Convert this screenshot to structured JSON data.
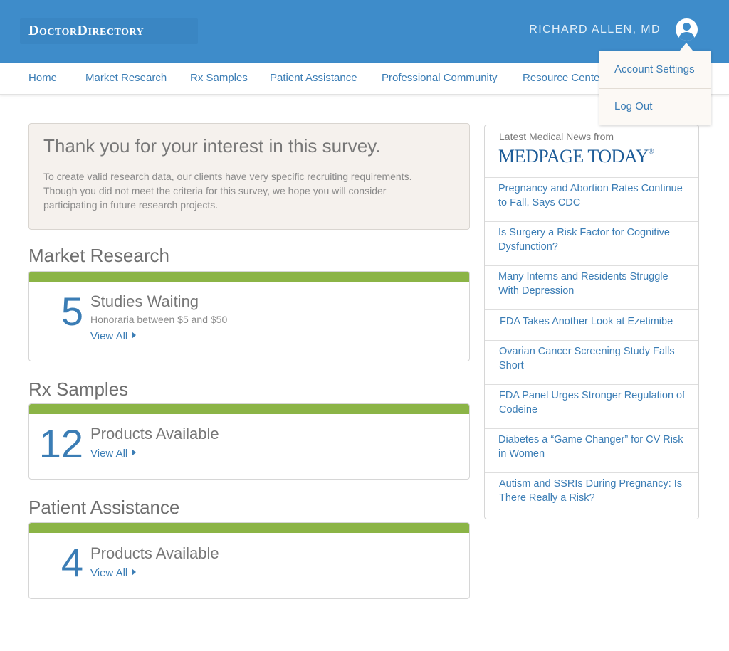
{
  "header": {
    "logo": "DoctorDirectory",
    "user_name": "RICHARD ALLEN, MD"
  },
  "nav": {
    "items": [
      {
        "label": "Home"
      },
      {
        "label": "Market Research"
      },
      {
        "label": "Rx Samples"
      },
      {
        "label": "Patient Assistance"
      },
      {
        "label": "Professional Community"
      },
      {
        "label": "Resource Center"
      }
    ]
  },
  "user_menu": {
    "items": [
      {
        "label": "Account Settings"
      },
      {
        "label": "Log Out"
      }
    ]
  },
  "thanks": {
    "title": "Thank you for your interest in this survey.",
    "body": "To create valid research data, our clients have very specific recruiting requirements. Though you did not meet the criteria for this survey, we hope you will consider participating in future research projects."
  },
  "sections": [
    {
      "title": "Market Research",
      "count": "5",
      "heading": "Studies Waiting",
      "sub": "Honoraria between $5 and $50",
      "link": "View All"
    },
    {
      "title": "Rx Samples",
      "count": "12",
      "heading": "Products Available",
      "link": "View All"
    },
    {
      "title": "Patient Assistance",
      "count": "4",
      "heading": "Products Available",
      "link": "View All"
    }
  ],
  "news": {
    "heading": "Latest Medical News from",
    "source_logo": "MEDPAGE TODAY",
    "items": [
      {
        "title": "Pregnancy and Abortion Rates Continue to Fall, Says CDC"
      },
      {
        "title": "Is Surgery a Risk Factor for Cognitive Dysfunction?"
      },
      {
        "title": "Many Interns and Residents Struggle With Depression"
      },
      {
        "title": "FDA Takes Another Look at Ezetimibe"
      },
      {
        "title": "Ovarian Cancer Screening Study Falls Short"
      },
      {
        "title": "FDA Panel Urges Stronger Regulation of Codeine"
      },
      {
        "title": "Diabetes a “Game Changer” for CV Risk in Women"
      },
      {
        "title": "Autism and SSRIs During Pregnancy: Is There Really a Risk?"
      }
    ]
  },
  "colors": {
    "header_blue": "#3e8cca",
    "link_blue": "#3b7db5",
    "accent_green": "#8bb446"
  }
}
